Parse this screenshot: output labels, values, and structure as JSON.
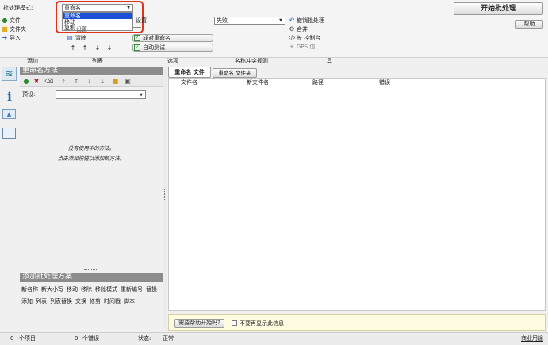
{
  "toolbar": {
    "mode_label": "批处理模式:",
    "mode_value": "重命名",
    "mode_options": [
      "重命名",
      "移动",
      "复制"
    ],
    "start_button": "开始批处理",
    "help_button": "帮助",
    "left_actions": [
      "文件",
      "文件夹",
      "导入"
    ],
    "col2_labels": [
      "设置",
      "清除"
    ],
    "middle_checks": [
      "成对重命名",
      "自动测试"
    ],
    "conflict_value": "失败",
    "tools": [
      "撤销批处理",
      "合并",
      "长 控制台",
      "GPS 值"
    ],
    "section_labels": [
      "添加",
      "列表",
      "选项",
      "名称冲突规则",
      "工具"
    ]
  },
  "left": {
    "rename_header": "重命名方法",
    "preset_label": "预设:",
    "preset_value": "",
    "empty_line1": "没有使用中的方法。",
    "empty_line2": "点击添加按钮以添加新方法。",
    "batch_header": "添加批处理方案",
    "batch_row1": [
      "新名称",
      "新大小写",
      "移动",
      "移除",
      "移除模式",
      "重新编号",
      "替换"
    ],
    "batch_row2": [
      "添加",
      "列表",
      "列表替换",
      "交换",
      "修剪",
      "时间戳",
      "脚本"
    ]
  },
  "right": {
    "tabs": [
      "重命名 文件",
      "重命名 文件夹"
    ],
    "columns": [
      "文件名",
      "新文件名",
      "路径",
      "错误"
    ],
    "help_button": "需要帮助开始吗?",
    "dont_show": "不要再显示此信息"
  },
  "status": {
    "items_count": "0",
    "items_label": "个项目",
    "errors_count": "0",
    "errors_label": "个错误",
    "state_label": "状态:",
    "state_value": "正常",
    "commercial": "商业用途"
  },
  "colors": {
    "highlight": "#1a4fd6",
    "annotation_red": "#e0321e",
    "panel_header": "#8c8c8c",
    "help_bar": "#fffbe0"
  }
}
